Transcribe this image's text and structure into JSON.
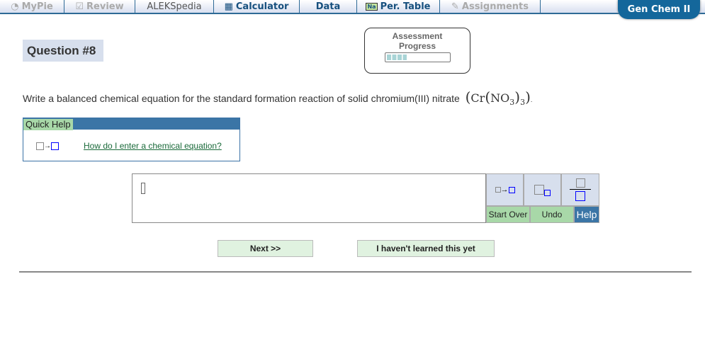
{
  "nav": {
    "tabs": [
      {
        "label": "MyPie",
        "icon": "pie-icon",
        "active": false
      },
      {
        "label": "Review",
        "icon": "check-icon",
        "active": false
      },
      {
        "label": "ALEKSpedia",
        "icon": "",
        "active": false
      },
      {
        "label": "Calculator",
        "icon": "calculator-icon",
        "active": true
      },
      {
        "label": "Data",
        "icon": "",
        "active": true
      },
      {
        "label": "Per. Table",
        "icon": "periodic-table-icon",
        "icon_text": "Na",
        "active": true
      },
      {
        "label": "Assignments",
        "icon": "assignment-icon",
        "active": false
      }
    ],
    "course": "Gen Chem II"
  },
  "question": {
    "number": "Question #8",
    "text": "Write a balanced chemical equation for the standard formation reaction of solid chromium(III) nitrate",
    "formula": {
      "open": "(",
      "el": "Cr",
      "paren_open": "(",
      "group": "NO",
      "sub1": "3",
      "paren_close": ")",
      "sub2": "3",
      "close": ")"
    },
    "end": "."
  },
  "progress": {
    "label": "Assessment Progress",
    "value": 0.33
  },
  "quick_help": {
    "title": "Quick Help",
    "link": "How do I enter a chemical equation?"
  },
  "toolbar": {
    "start_over": "Start Over",
    "undo": "Undo",
    "help": "Help"
  },
  "actions": {
    "next": "Next >>",
    "not_learned": "I haven't learned this yet"
  },
  "colors": {
    "brand": "#14679b",
    "green": "#a8d8a8",
    "help": "#3b75a6"
  }
}
